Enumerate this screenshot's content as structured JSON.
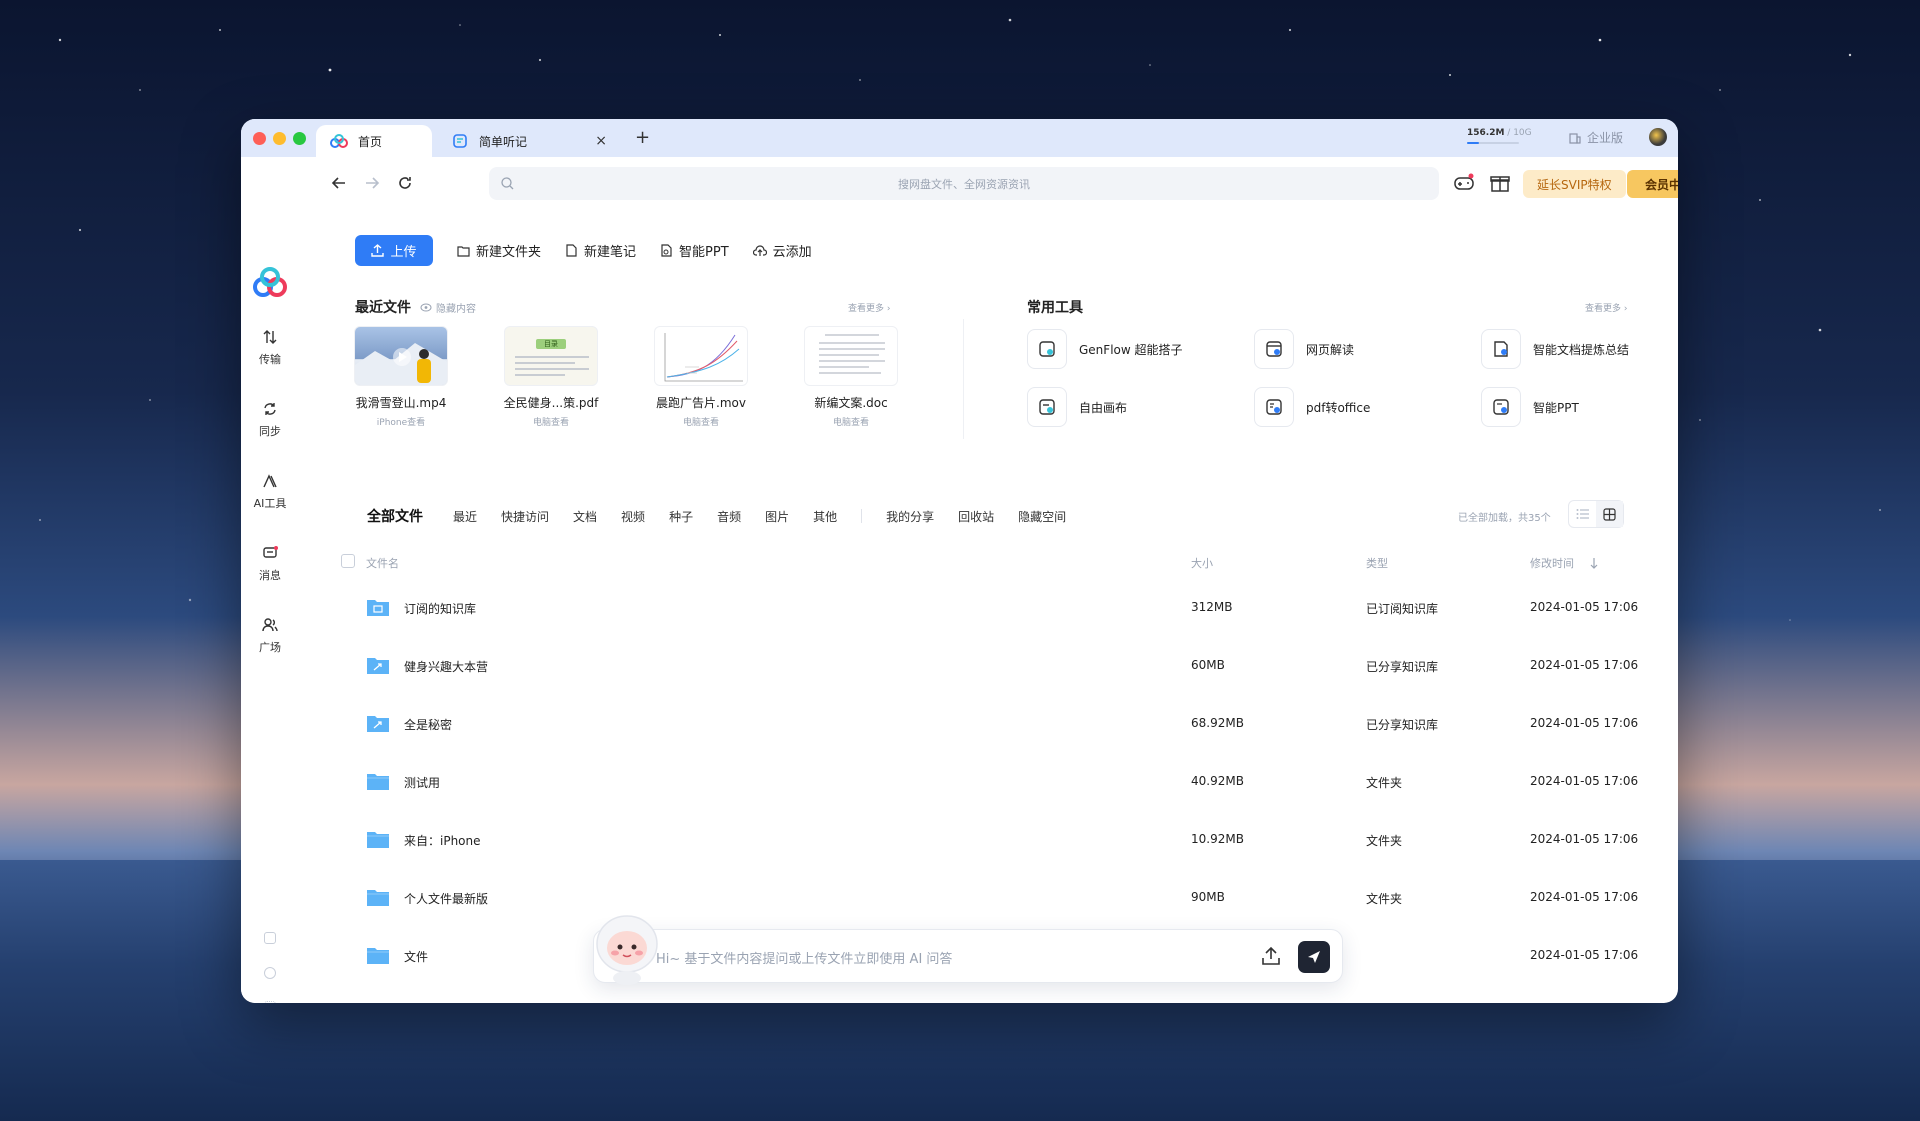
{
  "titlebar": {
    "tabs": [
      {
        "label": "首页",
        "active": true
      },
      {
        "label": "简单听记",
        "active": false
      }
    ],
    "new_tab": "+",
    "close": "×",
    "storage": {
      "used": "156.2M",
      "sep": " / ",
      "total": "10G"
    },
    "enterprise": "企业版"
  },
  "sidebar": {
    "items": [
      {
        "label": "传输",
        "icon": "transfer-icon"
      },
      {
        "label": "同步",
        "icon": "sync-icon"
      },
      {
        "label": "AI工具",
        "icon": "ai-tools-icon"
      },
      {
        "label": "消息",
        "icon": "message-icon"
      },
      {
        "label": "广场",
        "icon": "community-icon"
      }
    ]
  },
  "navbar": {
    "search_placeholder": "搜网盘文件、全网资源资讯",
    "svip_label": "延长SVIP特权",
    "vip_center_label": "会员中心"
  },
  "actions": {
    "upload": "上传",
    "new_folder": "新建文件夹",
    "new_note": "新建笔记",
    "smart_ppt": "智能PPT",
    "cloud_add": "云添加"
  },
  "recent": {
    "title": "最近文件",
    "hide_label": "隐藏内容",
    "see_more": "查看更多 ›",
    "files": [
      {
        "name": "我滑雪登山.mp4",
        "source": "iPhone查看",
        "kind": "video"
      },
      {
        "name": "全民健身...策.pdf",
        "source": "电脑查看",
        "kind": "pdf",
        "tag": "目录"
      },
      {
        "name": "晨跑广告片.mov",
        "source": "电脑查看",
        "kind": "chart"
      },
      {
        "name": "新编文案.doc",
        "source": "电脑查看",
        "kind": "doc"
      }
    ]
  },
  "tools": {
    "title": "常用工具",
    "see_more": "查看更多 ›",
    "items": [
      {
        "label": "GenFlow 超能搭子",
        "icon": "genflow-icon"
      },
      {
        "label": "网页解读",
        "icon": "web-reader-icon"
      },
      {
        "label": "智能文档提炼总结",
        "icon": "doc-summary-icon"
      },
      {
        "label": "自由画布",
        "icon": "canvas-icon"
      },
      {
        "label": "pdf转office",
        "icon": "pdf-convert-icon"
      },
      {
        "label": "智能PPT",
        "icon": "smart-ppt-icon"
      }
    ]
  },
  "file_tabs": {
    "items": [
      "全部文件",
      "最近",
      "快捷访问",
      "文档",
      "视频",
      "种子",
      "音频",
      "图片",
      "其他"
    ],
    "extra": [
      "我的分享",
      "回收站",
      "隐藏空间"
    ],
    "loaded_text": "已全部加载，共35个"
  },
  "table": {
    "headers": {
      "name": "文件名",
      "size": "大小",
      "type": "类型",
      "modified": "修改时间"
    },
    "rows": [
      {
        "name": "订阅的知识库",
        "size": "312MB",
        "type": "已订阅知识库",
        "time": "2024-01-05 17:06",
        "icon": "subscribed-folder-icon"
      },
      {
        "name": "健身兴趣大本营",
        "size": "60MB",
        "type": "已分享知识库",
        "time": "2024-01-05 17:06",
        "icon": "shared-folder-icon"
      },
      {
        "name": "全是秘密",
        "size": "68.92MB",
        "type": "已分享知识库",
        "time": "2024-01-05 17:06",
        "icon": "shared-folder-icon"
      },
      {
        "name": "测试用",
        "size": "40.92MB",
        "type": "文件夹",
        "time": "2024-01-05 17:06",
        "icon": "folder-icon"
      },
      {
        "name": "来自：iPhone",
        "size": "10.92MB",
        "type": "文件夹",
        "time": "2024-01-05 17:06",
        "icon": "folder-icon"
      },
      {
        "name": "个人文件最新版",
        "size": "90MB",
        "type": "文件夹",
        "time": "2024-01-05 17:06",
        "icon": "folder-icon"
      },
      {
        "name": "文件",
        "size": "",
        "type": "",
        "time": "2024-01-05 17:06",
        "icon": "folder-icon"
      }
    ]
  },
  "ai_bar": {
    "placeholder": "Hi~ 基于文件内容提问或上传文件立即使用 AI 问答"
  },
  "colors": {
    "accent": "#2f7cf6",
    "svip_bg": "#fdebc8",
    "vip_bg": "#f7c760"
  }
}
